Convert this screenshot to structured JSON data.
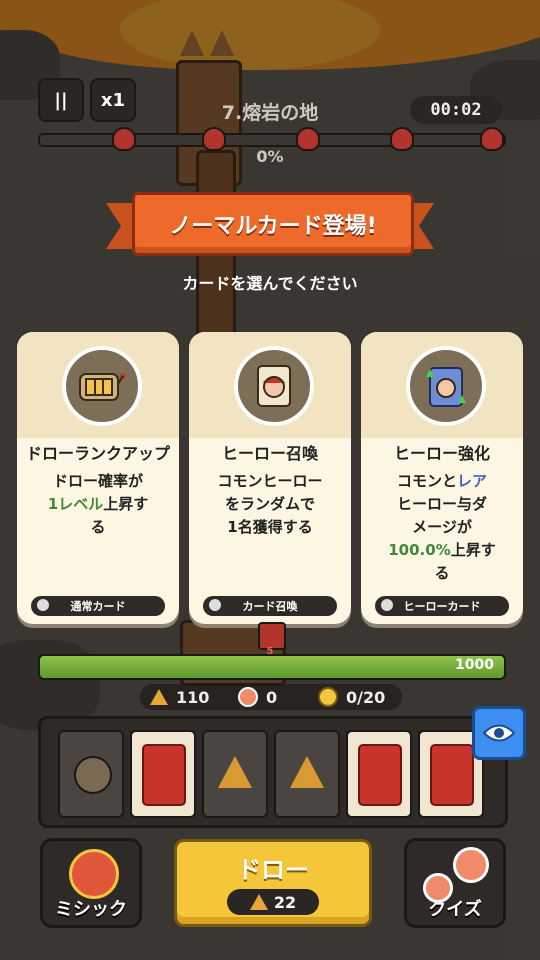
{
  "hud": {
    "pause_label": "||",
    "speed_label": "x1",
    "stage_title": "7.熔岩の地",
    "timer": "00:02",
    "wave_progress_text": "0%",
    "wave_progress": 0
  },
  "banner": {
    "title": "ノーマルカード登場!",
    "subtitle": "カードを選んでください"
  },
  "cards": [
    {
      "icon": "slot-machine-icon",
      "title": "ドローランクアップ",
      "desc_lines": [
        "ドロー確率が",
        "1レベル上昇す",
        "る"
      ],
      "highlight": "1レベル",
      "tag_icon": "card-icon",
      "tag": "通常カード"
    },
    {
      "icon": "hero-card-icon",
      "title": "ヒーロー召喚",
      "desc_lines": [
        "コモンヒーロー",
        "をランダムで",
        "1名獲得する"
      ],
      "tag_icon": "summon-icon",
      "tag": "カード召喚"
    },
    {
      "icon": "hero-upgrade-icon",
      "title": "ヒーロー強化",
      "desc_lines": [
        "コモンとレア",
        "ヒーロー与ダ",
        "メージが",
        "100.0%上昇す",
        "る"
      ],
      "highlight_blue": "レア",
      "highlight": "100.0%",
      "tag_icon": "sword-icon",
      "tag": "ヒーローカード"
    }
  ],
  "base": {
    "hp": "1000",
    "hp_fraction": 1.0,
    "gate_level": "5"
  },
  "resources": {
    "gold": "110",
    "gems": "0",
    "heroes": "0/20"
  },
  "draw": {
    "label": "ドロー",
    "cost": "22"
  },
  "buttons": {
    "mythic": "ミシック",
    "quiz": "クイズ"
  },
  "colors": {
    "banner": "#ee6a2b",
    "green_text": "#3f8a3a",
    "blue_text": "#3e63c8",
    "draw_button": "#f5c53a",
    "eye_button": "#3c8ef0"
  }
}
